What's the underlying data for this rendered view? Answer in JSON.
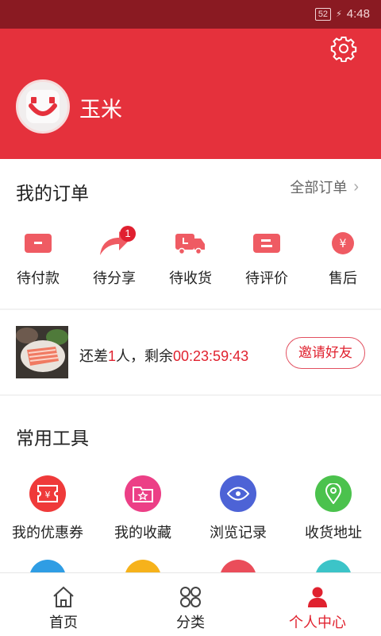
{
  "status_bar": {
    "battery": "52",
    "time": "4:48"
  },
  "profile": {
    "username": "玉米"
  },
  "orders": {
    "title": "我的订单",
    "all_label": "全部订单",
    "items": [
      {
        "label": "待付款",
        "icon": "wallet-icon"
      },
      {
        "label": "待分享",
        "icon": "share-icon",
        "badge": "1"
      },
      {
        "label": "待收货",
        "icon": "truck-icon"
      },
      {
        "label": "待评价",
        "icon": "comment-icon"
      },
      {
        "label": "售后",
        "icon": "yen-icon"
      }
    ]
  },
  "group_buy": {
    "text_prefix": "还差",
    "count": "1",
    "text_mid": "人，剩余",
    "countdown": "00:23:59:43",
    "invite_label": "邀请好友"
  },
  "tools": {
    "title": "常用工具",
    "items": [
      {
        "label": "我的优惠券",
        "icon": "coupon-icon",
        "color": "#ef3a3a"
      },
      {
        "label": "我的收藏",
        "icon": "favorite-folder-icon",
        "color": "#ec3f86"
      },
      {
        "label": "浏览记录",
        "icon": "eye-icon",
        "color": "#4d63d6"
      },
      {
        "label": "收货地址",
        "icon": "location-pin-icon",
        "color": "#4bc24d"
      }
    ],
    "row2_colors": [
      "#2f9de4",
      "#f6b21b",
      "#ea4d5a",
      "#3cc4c8"
    ]
  },
  "bottom_nav": [
    {
      "label": "首页",
      "icon": "home-icon",
      "active": false
    },
    {
      "label": "分类",
      "icon": "category-icon",
      "active": false
    },
    {
      "label": "个人中心",
      "icon": "user-icon",
      "active": true
    }
  ],
  "colors": {
    "brand_red": "#e5313c",
    "status_bar": "#8a1a22",
    "accent_text": "#e0222f"
  }
}
